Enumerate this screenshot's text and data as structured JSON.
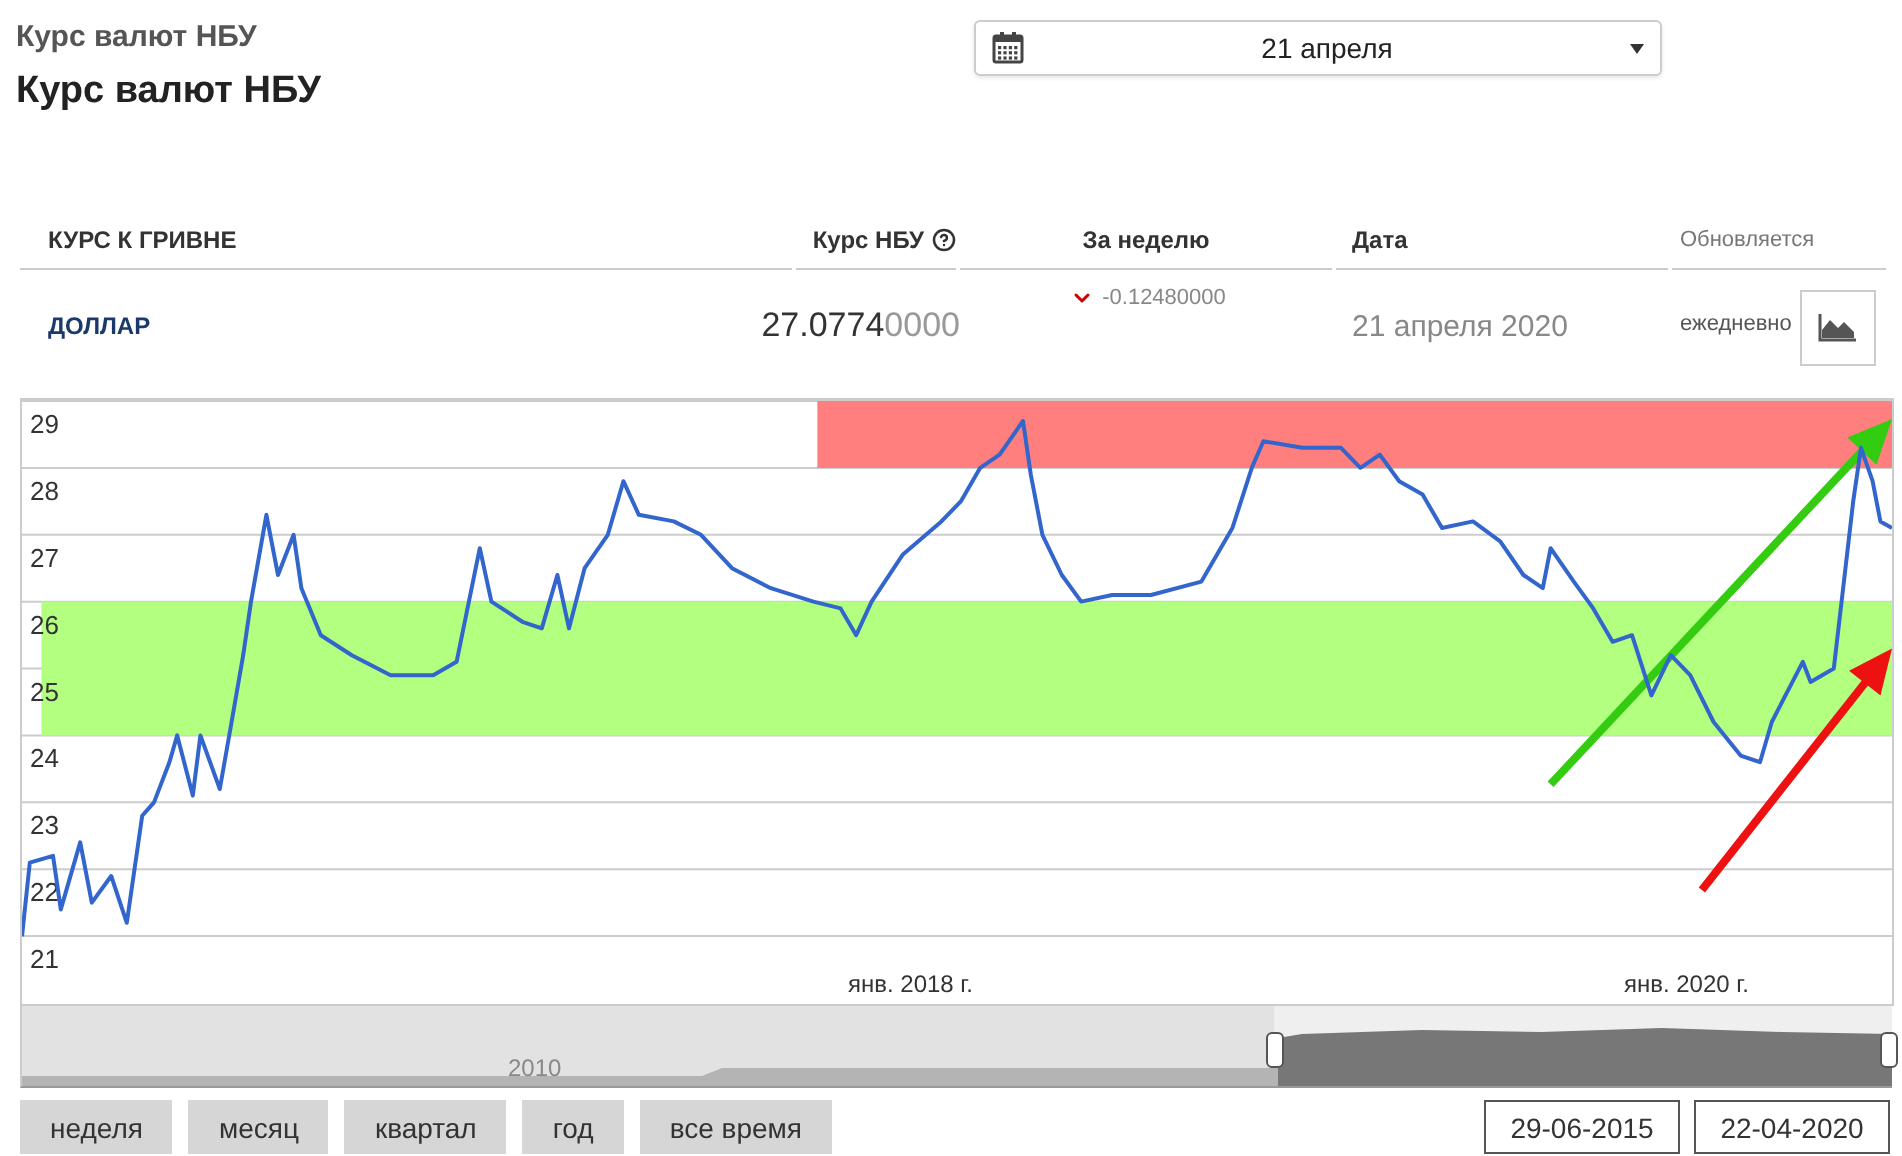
{
  "breadcrumb": "Курс валют НБУ",
  "title": "Курс валют НБУ",
  "date_picker": {
    "value": "21 апреля"
  },
  "table": {
    "columns": [
      {
        "label": "КУРС К ГРИВНЕ",
        "help": false
      },
      {
        "label": "Курс НБУ",
        "help": true
      },
      {
        "label": "За неделю",
        "help": false
      },
      {
        "label": "Дата",
        "help": false
      },
      {
        "label": "Обновляется",
        "help": false
      }
    ],
    "rows": [
      {
        "currency": "ДОЛЛАР",
        "rate": {
          "value": "27.0774",
          "trailing_zeros": "0000"
        },
        "change": {
          "decreased": true,
          "value": "-0.12480000"
        },
        "date": "21 апреля 2020",
        "updates": "ежедневно"
      }
    ]
  },
  "chart": {
    "chart_data": {
      "type": "line",
      "grid": true,
      "ylim": [
        20,
        29
      ],
      "xlim": [
        2015.71,
        2020.53
      ],
      "yticks": [
        21,
        22,
        23,
        24,
        25,
        26,
        27,
        28,
        29
      ],
      "xticks": [
        {
          "value": 2018,
          "label": "янв. 2018 г."
        },
        {
          "value": 2020,
          "label": "янв. 2020 г."
        }
      ],
      "bands": [
        {
          "axis": "y",
          "from": 24,
          "to": 26,
          "color": "#b3ff80"
        },
        {
          "axis": "y",
          "from": 28,
          "to": 29,
          "color": "#ff7f7f"
        }
      ],
      "series": [
        {
          "color": "#3366cc",
          "x": [
            2015.71,
            2015.73,
            2015.79,
            2015.81,
            2015.86,
            2015.89,
            2015.94,
            2015.98,
            2016.02,
            2016.05,
            2016.09,
            2016.11,
            2016.15,
            2016.17,
            2016.22,
            2016.25,
            2016.28,
            2016.3,
            2016.34,
            2016.37,
            2016.41,
            2016.43,
            2016.48,
            2016.56,
            2016.66,
            2016.77,
            2016.83,
            2016.89,
            2016.92,
            2017.0,
            2017.05,
            2017.09,
            2017.12,
            2017.16,
            2017.22,
            2017.26,
            2017.3,
            2017.39,
            2017.46,
            2017.54,
            2017.64,
            2017.75,
            2017.82,
            2017.86,
            2017.9,
            2017.98,
            2018.08,
            2018.13,
            2018.18,
            2018.23,
            2018.29,
            2018.31,
            2018.34,
            2018.39,
            2018.44,
            2018.52,
            2018.62,
            2018.75,
            2018.83,
            2018.88,
            2018.91,
            2019.01,
            2019.11,
            2019.16,
            2019.21,
            2019.26,
            2019.32,
            2019.37,
            2019.45,
            2019.52,
            2019.58,
            2019.63,
            2019.65,
            2019.71,
            2019.76,
            2019.81,
            2019.86,
            2019.91,
            2019.96,
            2020.01,
            2020.07,
            2020.14,
            2020.19,
            2020.22,
            2020.3,
            2020.32,
            2020.38,
            2020.4,
            2020.43,
            2020.45,
            2020.48,
            2020.5,
            2020.53
          ],
          "values": [
            21.0,
            22.1,
            22.2,
            21.4,
            22.4,
            21.5,
            21.9,
            21.2,
            22.8,
            23.0,
            23.6,
            24.0,
            23.1,
            24.0,
            23.2,
            24.2,
            25.2,
            26.0,
            27.3,
            26.4,
            27.0,
            26.2,
            25.5,
            25.2,
            24.9,
            24.9,
            25.1,
            26.8,
            26.0,
            25.7,
            25.6,
            26.4,
            25.6,
            26.5,
            27.0,
            27.8,
            27.3,
            27.2,
            27.0,
            26.5,
            26.2,
            26.0,
            25.9,
            25.5,
            26.0,
            26.7,
            27.2,
            27.5,
            28.0,
            28.2,
            28.7,
            27.9,
            27.0,
            26.4,
            26.0,
            26.1,
            26.1,
            26.3,
            27.1,
            28.0,
            28.4,
            28.3,
            28.3,
            28.0,
            28.2,
            27.8,
            27.6,
            27.1,
            27.2,
            26.9,
            26.4,
            26.2,
            26.8,
            26.3,
            25.9,
            25.4,
            25.5,
            24.6,
            25.2,
            24.9,
            24.2,
            23.7,
            23.6,
            24.2,
            25.1,
            24.8,
            25.0,
            26.0,
            27.5,
            28.3,
            27.8,
            27.2,
            27.1
          ]
        }
      ]
    },
    "overlays": [
      {
        "kind": "arrow",
        "color": "#33cc11"
      },
      {
        "kind": "arrow",
        "color": "#ee1111"
      }
    ]
  },
  "navigator": {
    "year_label": "2010"
  },
  "range_buttons": [
    "неделя",
    "месяц",
    "квартал",
    "год",
    "все время"
  ],
  "date_range": {
    "from": "29-06-2015",
    "to": "22-04-2020"
  }
}
